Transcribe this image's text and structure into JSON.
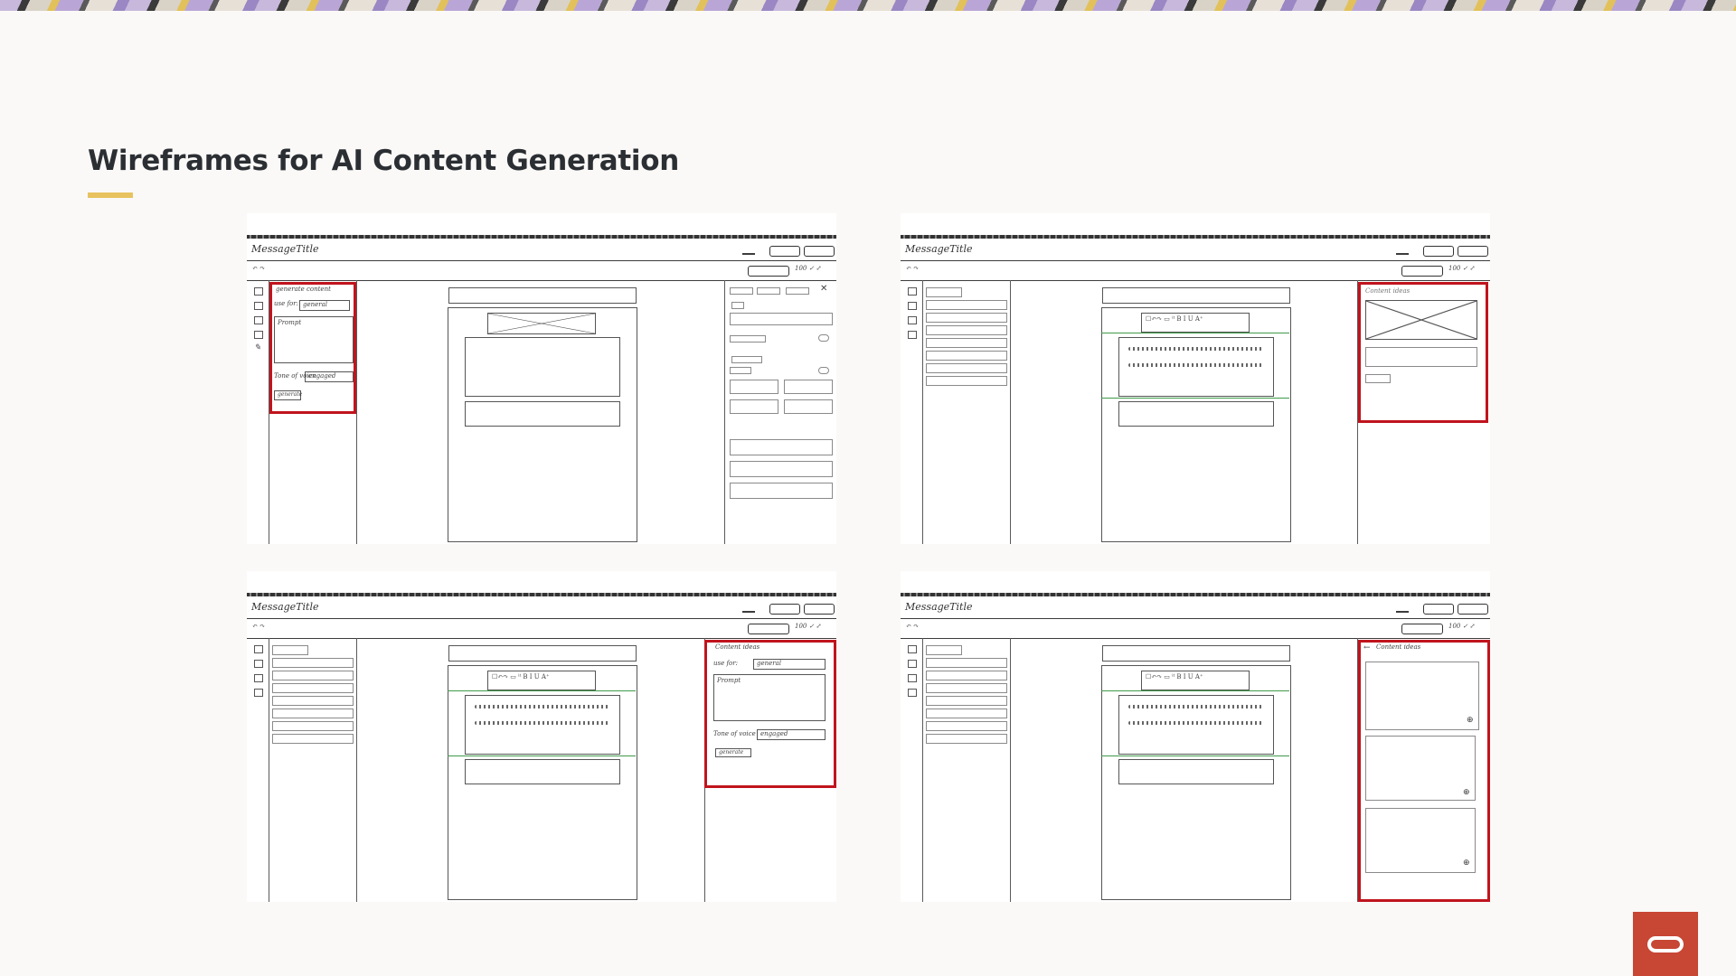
{
  "slide": {
    "title": "Wireframes for AI Content Generation"
  },
  "wireframes": [
    {
      "window_title": "MessageTitle",
      "panel_heading": "generate content",
      "field_label": "use for:",
      "field_value": "general",
      "prompt_text": "Prompt",
      "tone_label": "Tone of voice",
      "tone_value": "engaged",
      "button_label": "generate"
    },
    {
      "window_title": "MessageTitle",
      "panel_heading": "Content ideas"
    },
    {
      "window_title": "MessageTitle",
      "panel_heading": "Content ideas",
      "field_label": "use for:",
      "field_value": "general",
      "prompt_text": "Prompt",
      "tone_label": "Tone of voice",
      "tone_value": "engaged",
      "button_label": "generate"
    },
    {
      "window_title": "MessageTitle",
      "panel_heading": "Content ideas"
    }
  ],
  "colors": {
    "highlight": "#c0141d",
    "title_accent": "#e7c25f",
    "logo_bg": "#c74634"
  },
  "logo": {
    "name": "oracle-logo"
  }
}
